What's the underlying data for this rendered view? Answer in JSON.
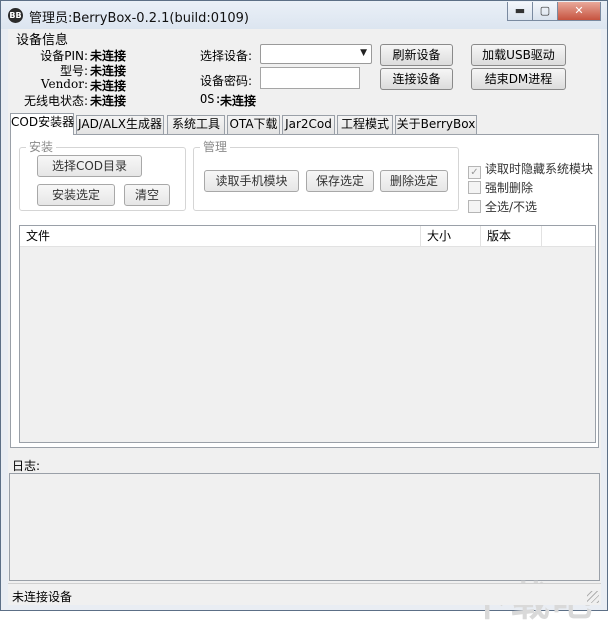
{
  "window": {
    "title": "管理员:BerryBox-0.2.1(build:0109)",
    "app_icon_text": "BB",
    "minimize_glyph": "▬",
    "maximize_glyph": "▢",
    "close_glyph": "✕"
  },
  "device_info": {
    "group_label": "设备信息",
    "pin_label": "设备PIN:",
    "pin_value": "未连接",
    "model_label": "型号:",
    "model_value": "未连接",
    "vendor_label": "Vendor:",
    "vendor_value": "未连接",
    "radio_label": "无线电状态:",
    "radio_value": "未连接",
    "select_device_label": "选择设备:",
    "select_device_value": "",
    "device_password_label": "设备密码:",
    "device_password_value": "",
    "os_label": "OS:",
    "os_value": "未连接",
    "refresh_button": "刷新设备",
    "connect_button": "连接设备",
    "load_usb_button": "加载USB驱动",
    "end_dm_button": "结束DM进程"
  },
  "tabs": [
    "COD安装器",
    "JAD/ALX生成器",
    "系统工具",
    "OTA下载",
    "Jar2Cod",
    "工程模式",
    "关于BerryBox"
  ],
  "install_group": {
    "title": "安装",
    "select_dir_button": "选择COD目录",
    "install_selected_button": "安装选定",
    "clear_button": "清空"
  },
  "manage_group": {
    "title": "管理",
    "read_modules_button": "读取手机模块",
    "save_selected_button": "保存选定",
    "delete_selected_button": "删除选定"
  },
  "options": {
    "hide_system_label": "读取时隐藏系统模块",
    "hide_system_checked": true,
    "force_delete_label": "强制删除",
    "force_delete_checked": false,
    "select_all_label": "全选/不选",
    "select_all_checked": false
  },
  "file_list": {
    "columns": [
      "文件",
      "大小",
      "版本"
    ],
    "rows": []
  },
  "log": {
    "label": "日志:"
  },
  "status": {
    "text": "未连接设备"
  },
  "watermark": {
    "text": "下载吧"
  }
}
